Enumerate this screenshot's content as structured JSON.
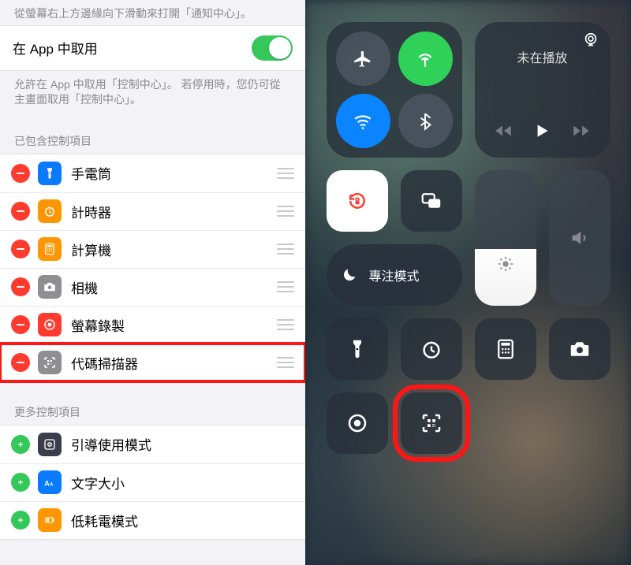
{
  "settings": {
    "swipe_hint": "從螢幕右上方邊緣向下滑動來打開「通知中心」。",
    "access_in_app": {
      "label": "在 App 中取用",
      "enabled": true
    },
    "access_in_app_note": "允許在 App 中取用「控制中心」。 若停用時，您仍可從主畫面取用「控制中心」。",
    "included_header": "已包含控制項目",
    "included": [
      {
        "id": "flashlight",
        "label": "手電筒",
        "icon_bg": "#0a7aff",
        "highlight": false
      },
      {
        "id": "timer",
        "label": "計時器",
        "icon_bg": "#ff9500",
        "highlight": false
      },
      {
        "id": "calculator",
        "label": "計算機",
        "icon_bg": "#ff9500",
        "highlight": false
      },
      {
        "id": "camera",
        "label": "相機",
        "icon_bg": "#8e8e93",
        "highlight": false
      },
      {
        "id": "screen-record",
        "label": "螢幕錄製",
        "icon_bg": "#ff3b30",
        "highlight": false
      },
      {
        "id": "code-scanner",
        "label": "代碼掃描器",
        "icon_bg": "#8e8e93",
        "highlight": true
      }
    ],
    "more_header": "更多控制項目",
    "more": [
      {
        "id": "guided-access",
        "label": "引導使用模式",
        "icon_bg": "#3b3d4a"
      },
      {
        "id": "text-size",
        "label": "文字大小",
        "icon_bg": "#0a7aff"
      },
      {
        "id": "low-power",
        "label": "低耗電模式",
        "icon_bg": "#ff9500"
      }
    ]
  },
  "control_center": {
    "connectivity": {
      "airplane": {
        "on": false,
        "icon": "airplane"
      },
      "cellular": {
        "on": true,
        "icon": "antenna"
      },
      "wifi": {
        "on": true,
        "icon": "wifi"
      },
      "bluetooth": {
        "on": false,
        "icon": "bluetooth"
      }
    },
    "media": {
      "title": "未在播放"
    },
    "orientation_lock": {
      "on": true
    },
    "focus": {
      "label": "專注模式"
    },
    "brightness_percent": 42,
    "volume_percent": 0,
    "shortcuts_row": [
      "flashlight",
      "timer",
      "calculator",
      "camera"
    ],
    "extra_row": [
      "screen-record",
      "code-scanner"
    ],
    "highlight": "code-scanner"
  }
}
